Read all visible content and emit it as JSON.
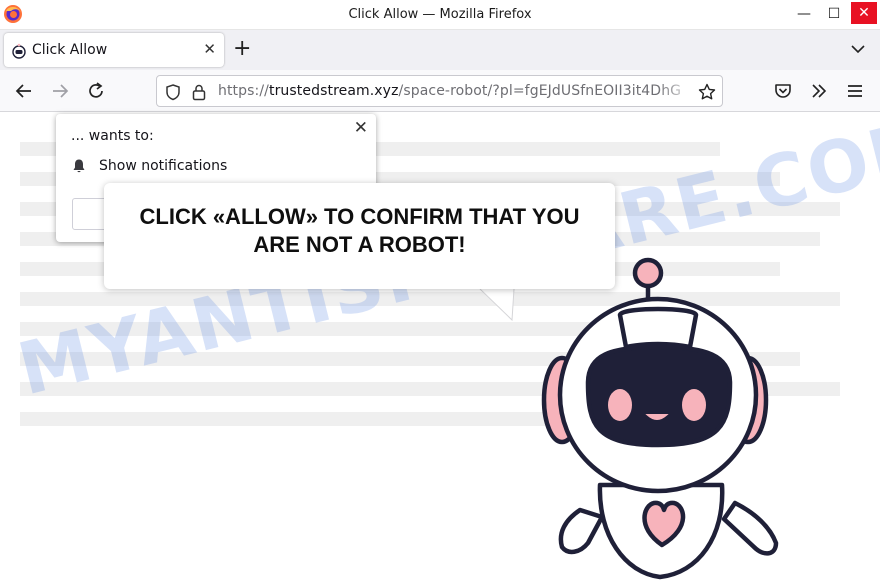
{
  "window": {
    "title": "Click Allow — Mozilla Firefox",
    "minimize_glyph": "—",
    "maximize_glyph": "☐",
    "close_glyph": "✕"
  },
  "tab": {
    "label": "Click Allow",
    "close_glyph": "✕",
    "new_tab_glyph": "+"
  },
  "address_bar": {
    "prefix": "https://",
    "domain": "trustedstream.xyz",
    "path": "/space-robot/?pl=fgEJdUSfnEOII3it4DhG"
  },
  "notification_prompt": {
    "wants_to": "... wants to:",
    "permission": "Show notifications",
    "close_glyph": "✕"
  },
  "bubble": {
    "message": "CLICK «ALLOW» TO CONFIRM THAT YOU ARE NOT A ROBOT!"
  },
  "watermark": {
    "text": "MYANTISPYWARE.COM"
  },
  "colors": {
    "close_red": "#e81123",
    "robot_pink": "#f7b3bb",
    "robot_outline": "#1f2038",
    "watermark_blue": "#6e96e6"
  },
  "icons": [
    "firefox-logo-icon",
    "robot-favicon-icon",
    "back-icon",
    "forward-icon",
    "reload-icon",
    "shield-icon",
    "lock-icon",
    "star-icon",
    "pocket-icon",
    "extensions-chevron-icon",
    "menu-icon",
    "bell-icon",
    "list-all-tabs-icon"
  ]
}
